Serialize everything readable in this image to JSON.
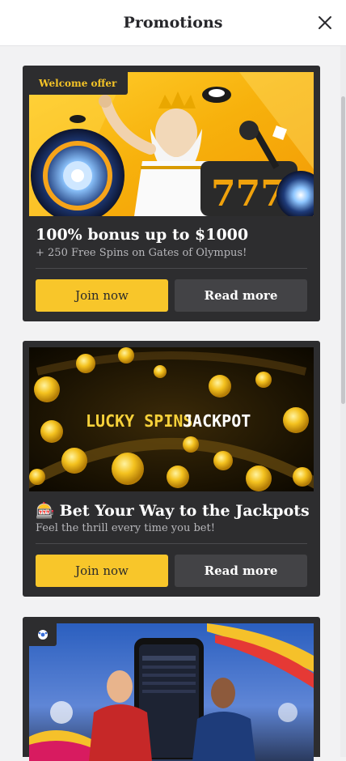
{
  "header": {
    "title": "Promotions"
  },
  "promotions": [
    {
      "badge": "Welcome offer",
      "title": "100% bonus up to $1000",
      "subtitle": "+ 250 Free Spins on Gates of Olympus!",
      "join_label": "Join now",
      "read_label": "Read more",
      "image_icon": "zeus-slot-banner"
    },
    {
      "emoji": "🎰",
      "title": "Bet Your Way to the Jackpots",
      "subtitle": "Feel the thrill every time you bet!",
      "join_label": "Join now",
      "read_label": "Read more",
      "image_text_a": "LUCKY SPINS",
      "image_text_b": "JACKPOT"
    },
    {
      "badge_icon": "soccer-ball-icon",
      "image_icon": "football-players-banner"
    }
  ],
  "colors": {
    "accent": "#f8c62a",
    "card_bg": "#2d2d2f",
    "page_bg": "#f2f2f3"
  }
}
